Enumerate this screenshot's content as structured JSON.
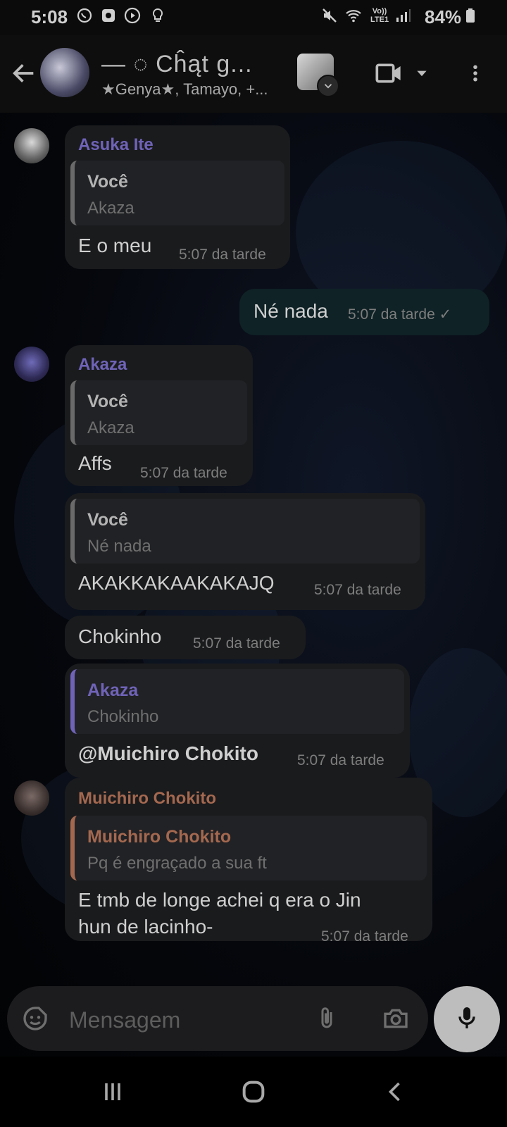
{
  "status_bar": {
    "time": "5:08",
    "network_label_top": "Vo))",
    "network_label_bottom": "LTE1",
    "battery": "84%"
  },
  "header": {
    "title": "— ◌ Cĥąt g...",
    "subtitle": "★Genya★, Tamayo, +..."
  },
  "messages": [
    {
      "sender": "Asuka Ite",
      "sender_color": "#6f63b8",
      "quote_name": "Você",
      "quote_text": "Akaza",
      "text": "E o meu",
      "time": "5:07 da tarde"
    },
    {
      "outgoing": true,
      "text": "Né nada",
      "time": "5:07 da tarde ✓"
    },
    {
      "sender": "Akaza",
      "sender_color": "#6f63b8",
      "quote_name": "Você",
      "quote_text": "Akaza",
      "text": "Affs",
      "time": "5:07 da tarde"
    },
    {
      "quote_name": "Você",
      "quote_text": "Né nada",
      "text": "AKAKKAKAAKAKAJQ",
      "time": "5:07 da tarde"
    },
    {
      "text": "Chokinho",
      "time": "5:07 da tarde"
    },
    {
      "quote_name": "Akaza",
      "quote_text": "Chokinho",
      "quote_color": "#6f63b8",
      "text": "@Muichiro Chokito",
      "time": "5:07 da tarde"
    },
    {
      "sender": "Muichiro Chokito",
      "sender_color": "#a4684f",
      "quote_name": "Muichiro Chokito",
      "quote_text": "Pq é engraçado a sua ft",
      "quote_color": "#a4684f",
      "text_line1": "E tmb de longe achei q era o Jin",
      "text_line2": "hun de lacinho-",
      "time": "5:07 da tarde"
    }
  ],
  "input": {
    "placeholder": "Mensagem"
  },
  "icons": {
    "back": "arrow-back-icon",
    "video": "video-call-icon",
    "menu": "more-vert-icon",
    "sticker": "sticker-icon",
    "attach": "paperclip-icon",
    "camera": "camera-icon",
    "mic": "mic-icon"
  }
}
